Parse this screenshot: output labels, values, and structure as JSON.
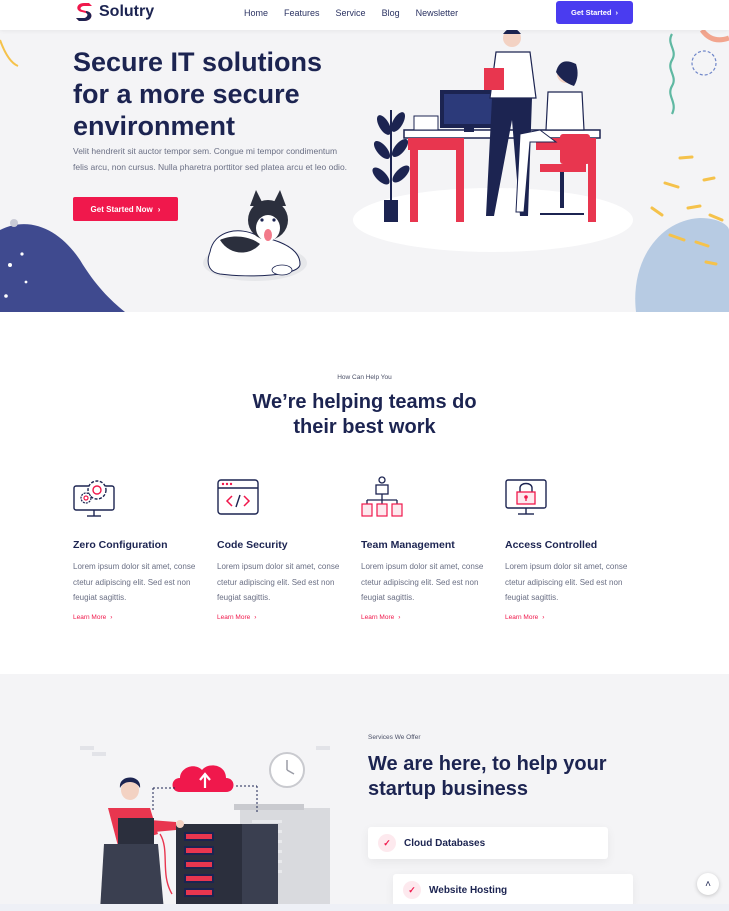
{
  "brand": {
    "name": "Solutry"
  },
  "nav": {
    "links": [
      "Home",
      "Features",
      "Service",
      "Blog",
      "Newsletter"
    ],
    "cta": "Get Started",
    "cta_arrow": "›"
  },
  "hero": {
    "title": "Secure IT solutions for a more secure environment",
    "description": "Velit hendrerit sit auctor tempor sem. Congue mi tempor condimentum felis arcu, non cursus. Nulla pharetra porttitor sed platea arcu et leo odio.",
    "cta": "Get Started Now",
    "cta_arrow": "›"
  },
  "help": {
    "eyebrow": "How Can Help You",
    "title": "We’re helping teams do their best work",
    "features": [
      {
        "title": "Zero Configuration",
        "text": "Lorem ipsum dolor sit amet, conse ctetur adipiscing elit. Sed est non feugiat sagittis.",
        "link": "Learn More",
        "icon": "gear-monitor-icon"
      },
      {
        "title": "Code Security",
        "text": "Lorem ipsum dolor sit amet, conse ctetur adipiscing elit. Sed est non feugiat sagittis.",
        "link": "Learn More",
        "icon": "code-window-icon"
      },
      {
        "title": "Team Management",
        "text": "Lorem ipsum dolor sit amet, conse ctetur adipiscing elit. Sed est non feugiat sagittis.",
        "link": "Learn More",
        "icon": "team-hierarchy-icon"
      },
      {
        "title": "Access Controlled",
        "text": "Lorem ipsum dolor sit amet, conse ctetur adipiscing elit. Sed est non feugiat sagittis.",
        "link": "Learn More",
        "icon": "lock-monitor-icon"
      }
    ],
    "link_arrow": "›"
  },
  "services": {
    "eyebrow": "Services We Offer",
    "title": "We are here, to help your startup business",
    "items": [
      "Cloud Databases",
      "Website Hosting"
    ],
    "check": "✓"
  },
  "scroll_top": {
    "icon": "chevron-up-icon",
    "glyph": "˄"
  },
  "colors": {
    "primary": "#f0184c",
    "accent": "#4a3cf0",
    "navy": "#1c2451",
    "hero_bg": "#f4f4f6"
  }
}
